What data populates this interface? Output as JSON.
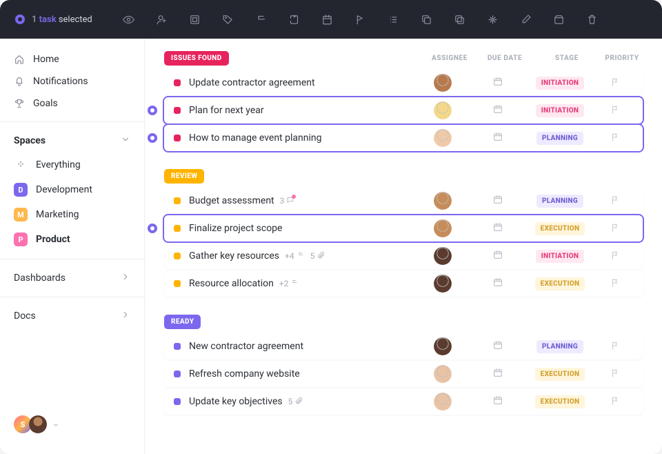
{
  "topbar": {
    "selection": {
      "count": "1",
      "task_word": "task",
      "selected_word": "selected"
    }
  },
  "sidebar": {
    "nav": [
      {
        "label": "Home"
      },
      {
        "label": "Notifications"
      },
      {
        "label": "Goals"
      }
    ],
    "spaces_header": "Spaces",
    "spaces": [
      {
        "letter": "",
        "label": "Everything",
        "color": ""
      },
      {
        "letter": "D",
        "label": "Development",
        "color": "#7b68ee"
      },
      {
        "letter": "M",
        "label": "Marketing",
        "color": "#ffb84d"
      },
      {
        "letter": "P",
        "label": "Product",
        "color": "#fd71af"
      }
    ],
    "dashboards_label": "Dashboards",
    "docs_label": "Docs"
  },
  "columns": {
    "assignee": "ASSIGNEE",
    "due": "DUE DATE",
    "stage": "STAGE",
    "priority": "PRIORITY"
  },
  "stages": {
    "initiation": "INITIATION",
    "planning": "PLANNING",
    "execution": "EXECUTION"
  },
  "groups": [
    {
      "name": "ISSUES FOUND",
      "color": "#e7235e",
      "status_color": "#e7235e",
      "tasks": [
        {
          "title": "Update contractor agreement",
          "stage": "initiation",
          "avatar": "#b87a4d",
          "selected": false
        },
        {
          "title": "Plan for next year",
          "stage": "initiation",
          "avatar": "#f4d88a",
          "selected": true
        },
        {
          "title": "How to manage event planning",
          "stage": "planning",
          "avatar": "#f0caa8",
          "selected": true
        }
      ]
    },
    {
      "name": "REVIEW",
      "color": "#ffb400",
      "status_color": "#ffb400",
      "tasks": [
        {
          "title": "Budget assessment",
          "stage": "planning",
          "avatar": "#c68d5a",
          "selected": false,
          "comments": "3",
          "comment_dot": true
        },
        {
          "title": "Finalize project scope",
          "stage": "execution",
          "avatar": "#c68d5a",
          "selected": true
        },
        {
          "title": "Gather key resources",
          "stage": "initiation",
          "avatar": "#5a3b2e",
          "selected": false,
          "subtasks": "+4",
          "attachments": "5"
        },
        {
          "title": "Resource allocation",
          "stage": "execution",
          "avatar": "#5a3b2e",
          "selected": false,
          "subtasks": "+2"
        }
      ]
    },
    {
      "name": "READY",
      "color": "#7b68ee",
      "status_color": "#7b68ee",
      "tasks": [
        {
          "title": "New contractor agreement",
          "stage": "planning",
          "avatar": "#5a3b2e",
          "selected": false
        },
        {
          "title": "Refresh company website",
          "stage": "execution",
          "avatar": "#e9c3a6",
          "selected": false
        },
        {
          "title": "Update key objectives",
          "stage": "execution",
          "avatar": "#e9c3a6",
          "selected": false,
          "attachments": "5"
        }
      ]
    }
  ],
  "user_avatar_letter": "S"
}
